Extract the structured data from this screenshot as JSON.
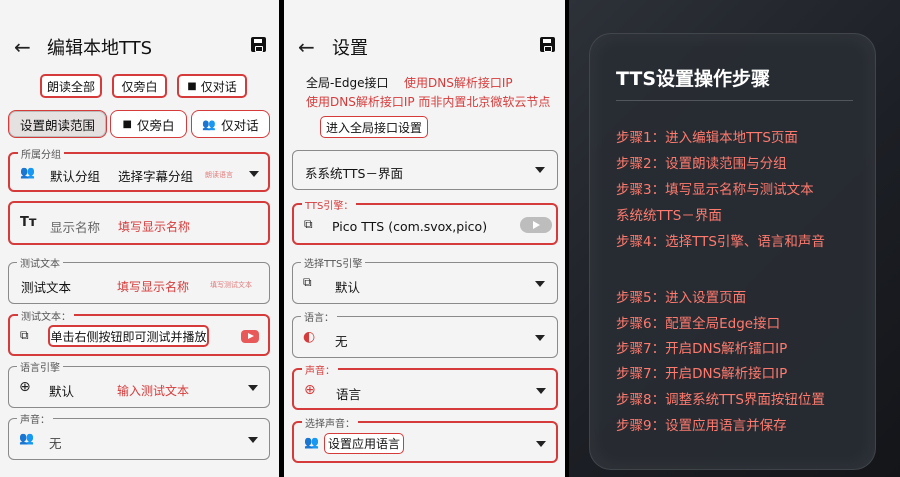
{
  "colors": {
    "accent_red": "#d63b3b",
    "card_text_red": "#ff7a6e"
  },
  "p1": {
    "title": "编辑本地TTS",
    "chips": [
      "朗读全部",
      "仅旁白",
      "仅对话"
    ],
    "segments": [
      "设置朗读范围",
      "仅旁白",
      "仅对话"
    ],
    "group": {
      "label": "所属分组",
      "value": "默认分组",
      "link": "选择字幕分组",
      "hint": "朗读语言"
    },
    "display": {
      "placeholder": "显示名称",
      "note": "填写显示名称"
    },
    "test1": {
      "label": "测试文本",
      "value": "测试文本",
      "note": "填写显示名称",
      "hint": "填写测试文本"
    },
    "test2": {
      "label": "测试文本：",
      "note": "单击右侧按钮即可测试并播放"
    },
    "lang": {
      "label": "语言引擎",
      "value": "默认",
      "note": "输入测试文本"
    },
    "voice": {
      "label": "声音：",
      "value": "无"
    }
  },
  "p2": {
    "title": "设置",
    "line1a": "全局-Edge接口",
    "line1b": "使用DNS解析接口IP",
    "line2": "使用DNS解析接口IP 而非内置北京微软云节点",
    "button": "进入全局接口设置",
    "system": {
      "value": "系系统TTS－界面"
    },
    "engine": {
      "label": "TTS引擎：",
      "value": "Pico TTS (com.svox,pico)"
    },
    "select": {
      "label": "选择TTS引擎",
      "value": "默认"
    },
    "language": {
      "label": "语言：",
      "value": "无"
    },
    "voice": {
      "label": "声音：",
      "value": "语言"
    },
    "selvoice": {
      "label": "选择声音：",
      "value": "设置应用语言"
    }
  },
  "p3": {
    "title": "TTS设置操作步骤",
    "steps": [
      "步骤1：进入编辑本地TTS页面",
      "步骤2：设置朗读范围与分组",
      "步骤3：填写显示名称与测试文本",
      "系统统TTS－界面",
      "步骤4：选择TTS引擎、语言和声音",
      "步骤5：进入设置页面",
      "步骤6：配置全局Edge接口",
      "步骤7：开启DNS解析镭口IP",
      "步骤7：开启DNS解析接口IP",
      "步骤8：调整系统TTS界面按钮位置",
      "步骤9：设置应用语言并保存"
    ]
  }
}
